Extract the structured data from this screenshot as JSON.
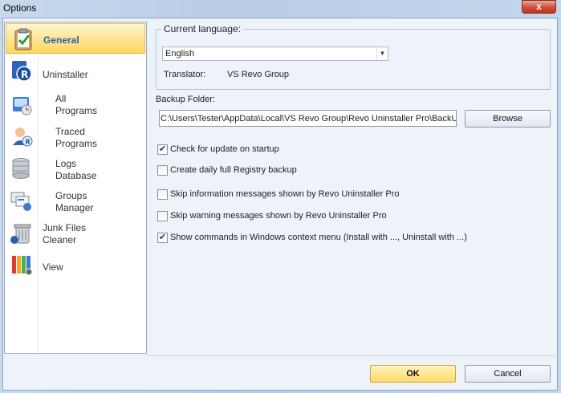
{
  "window": {
    "title": "Options",
    "close_label": "x"
  },
  "sidebar": {
    "items": [
      {
        "label": "General",
        "icon": "clipboard-check-icon",
        "active": true
      },
      {
        "label": "Uninstaller",
        "icon": "revo-uninstaller-icon"
      },
      {
        "label": "All\nPrograms",
        "icon": "all-programs-icon"
      },
      {
        "label": "Traced\nPrograms",
        "icon": "traced-programs-icon"
      },
      {
        "label": "Logs\nDatabase",
        "icon": "logs-database-icon"
      },
      {
        "label": "Groups\nManager",
        "icon": "groups-manager-icon"
      },
      {
        "label": "Junk Files\nCleaner",
        "icon": "junk-files-cleaner-icon"
      },
      {
        "label": "View",
        "icon": "view-icon"
      }
    ]
  },
  "language": {
    "group_label": "Current language:",
    "selected": "English",
    "translator_label": "Translator:",
    "translator_value": "VS Revo Group"
  },
  "backup": {
    "label": "Backup Folder:",
    "path": "C:\\Users\\Tester\\AppData\\Local\\VS Revo Group\\Revo Uninstaller Pro\\BackUp",
    "browse_label": "Browse"
  },
  "options": [
    {
      "label": "Check for update on startup",
      "checked": true
    },
    {
      "label": "Create daily full Registry backup",
      "checked": false
    },
    {
      "label": "Skip information messages shown by Revo Uninstaller Pro",
      "checked": false
    },
    {
      "label": "Skip warning messages shown by Revo Uninstaller Pro",
      "checked": false
    },
    {
      "label": "Show commands in Windows context menu (Install with ..., Uninstall with ...)",
      "checked": true
    }
  ],
  "footer": {
    "ok_label": "OK",
    "cancel_label": "Cancel"
  }
}
